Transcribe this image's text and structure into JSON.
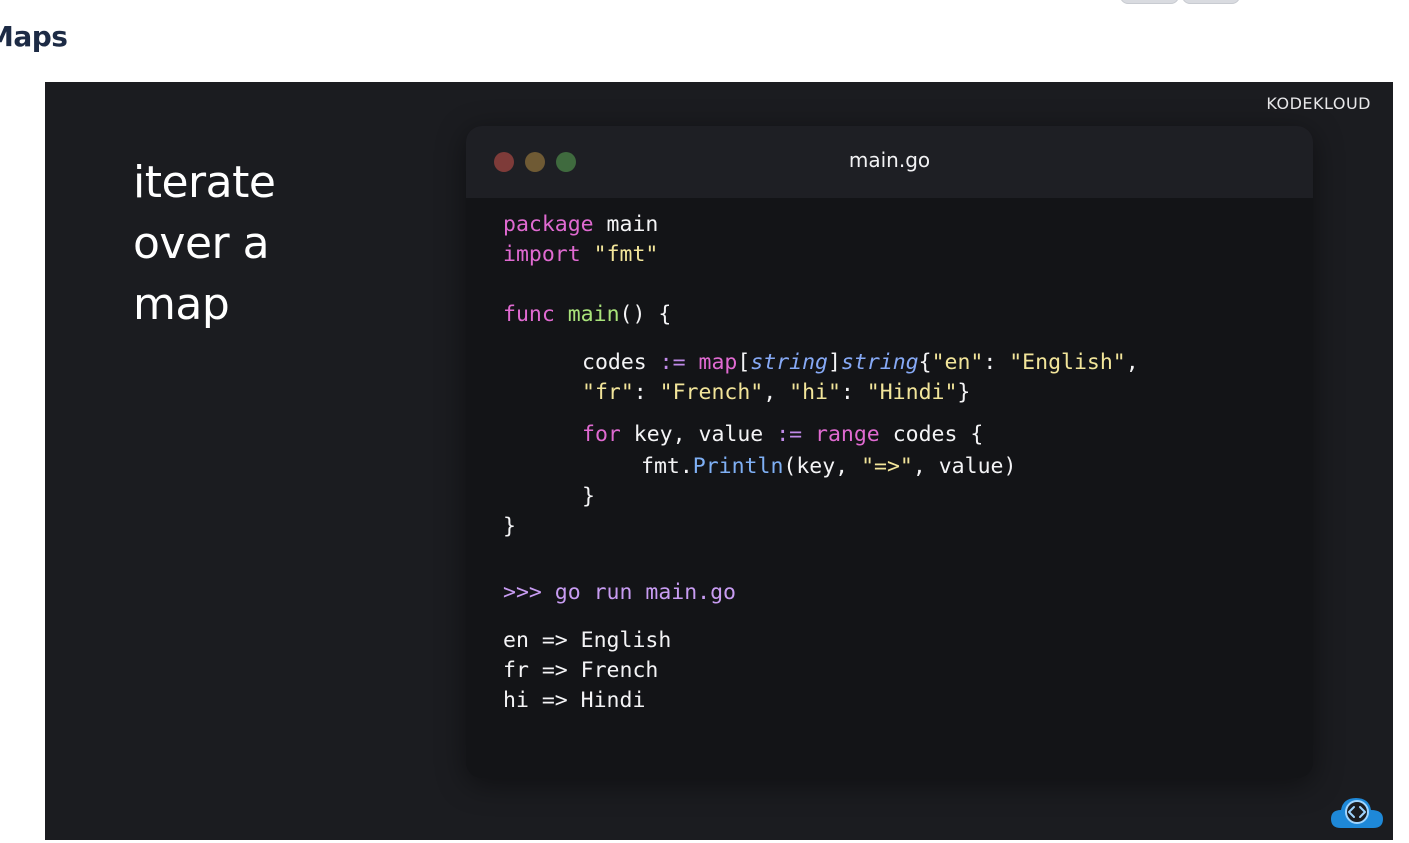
{
  "page": {
    "title": "Maps"
  },
  "slide": {
    "brand": "KODEKLOUD",
    "heading": [
      "iterate",
      "over a",
      "map"
    ],
    "window": {
      "filename": "main.go",
      "code_lines": [
        "package main",
        "import \"fmt\"",
        "func main() {",
        "codes := map[string]string{\"en\": \"English\",",
        "\"fr\": \"French\", \"hi\": \"Hindi\"}",
        "for key, value := range codes {",
        "fmt.Println(key, \"=>\", value)",
        "}",
        "}"
      ],
      "command": ">>> go run main.go",
      "output_lines": [
        "en => English",
        "fr => French",
        "hi => Hindi"
      ]
    }
  },
  "colors": {
    "slide_bg": "#1b1c20",
    "window_bg": "#131417",
    "keyword": "#e06ad1",
    "function": "#a8e27a",
    "string": "#f2e59a",
    "type": "#86a9f5",
    "prompt": "#c89cf2"
  },
  "icons": [
    "cloud-code-icon"
  ]
}
